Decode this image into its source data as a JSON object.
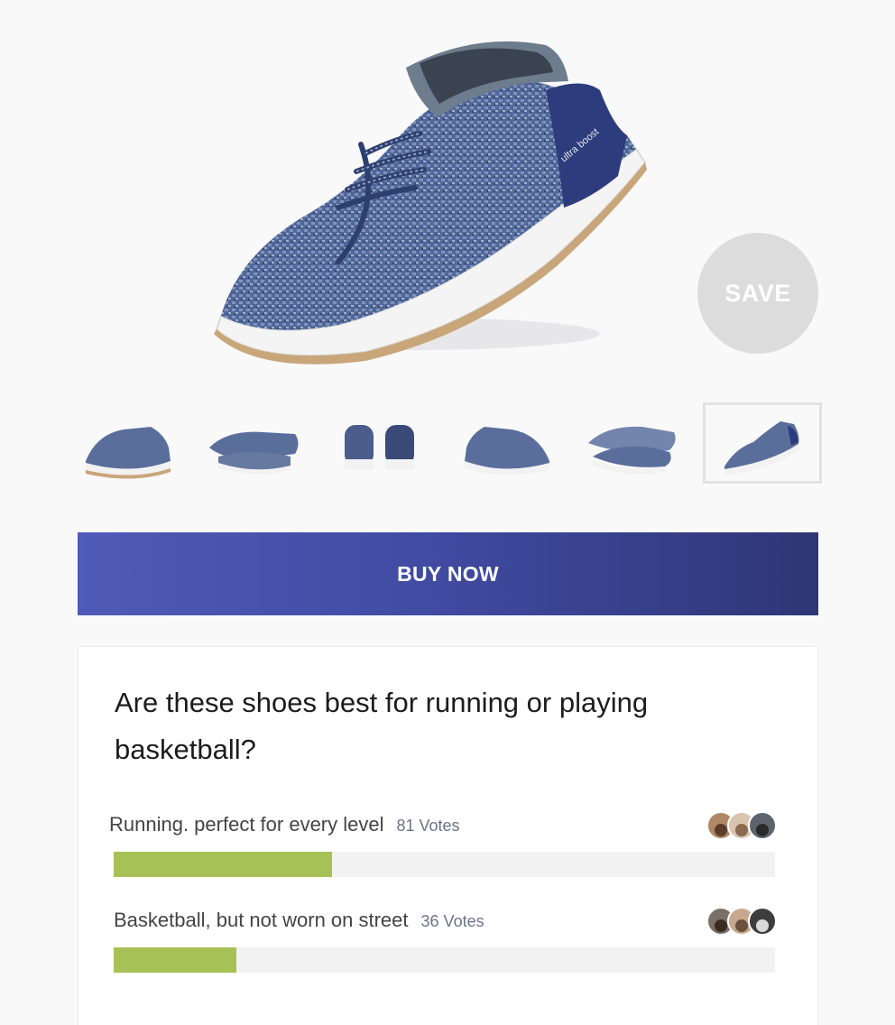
{
  "product": {
    "image_icon": "sneaker-image",
    "save_label": "SAVE",
    "buy_label": "BUY NOW",
    "selected_thumbnail": 6,
    "thumbnails": [
      {
        "name": "thumbnail-side-view"
      },
      {
        "name": "thumbnail-top-view"
      },
      {
        "name": "thumbnail-back-view"
      },
      {
        "name": "thumbnail-inner-view"
      },
      {
        "name": "thumbnail-pair-view"
      },
      {
        "name": "thumbnail-angle-view"
      }
    ]
  },
  "poll": {
    "question": "Are these shoes best for running or playing basketball?",
    "options": [
      {
        "label": "Running. perfect for every level",
        "votes": "81 Votes",
        "fraction": 0.33
      },
      {
        "label": "Basketball, but not worn on street",
        "votes": "36 Votes",
        "fraction": 0.185
      }
    ]
  },
  "colors": {
    "accent": "#4f5bb8",
    "bar_fill": "#a6c155",
    "bar_track": "#f2f2f2",
    "save_bg": "#dcdcdc"
  }
}
